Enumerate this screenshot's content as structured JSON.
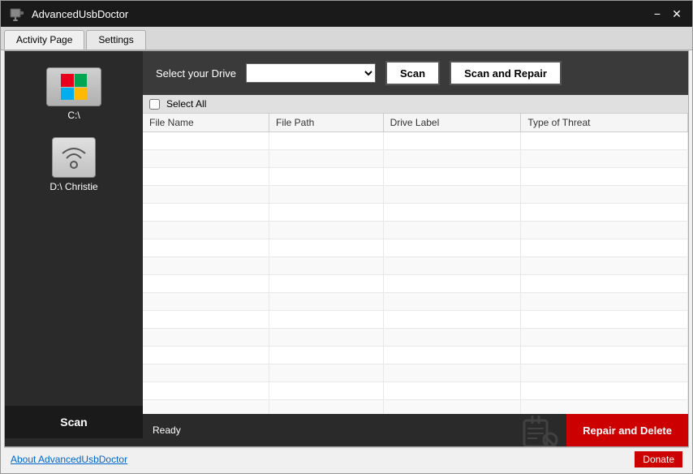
{
  "window": {
    "title": "AdvancedUsbDoctor",
    "icon": "usb-icon"
  },
  "title_controls": {
    "minimize": "−",
    "close": "✕"
  },
  "tabs": [
    {
      "label": "Activity Page",
      "active": true
    },
    {
      "label": "Settings",
      "active": false
    }
  ],
  "left_panel": {
    "drives": [
      {
        "label": "C:\\",
        "type": "windows"
      },
      {
        "label": "D:\\ Christie",
        "type": "usb"
      }
    ],
    "scan_button": "Scan"
  },
  "drive_selector": {
    "label": "Select your Drive",
    "placeholder": "",
    "options": []
  },
  "action_buttons": {
    "scan": "Scan",
    "scan_and_repair": "Scan and Repair"
  },
  "file_list": {
    "select_all_label": "Select All",
    "columns": [
      "File Name",
      "File Path",
      "Drive Label",
      "Type of Threat"
    ],
    "rows": []
  },
  "status_bar": {
    "status_text": "Ready",
    "repair_delete_button": "Repair and Delete"
  },
  "footer": {
    "about_link": "About AdvancedUsbDoctor",
    "donate_button": "Donate"
  }
}
